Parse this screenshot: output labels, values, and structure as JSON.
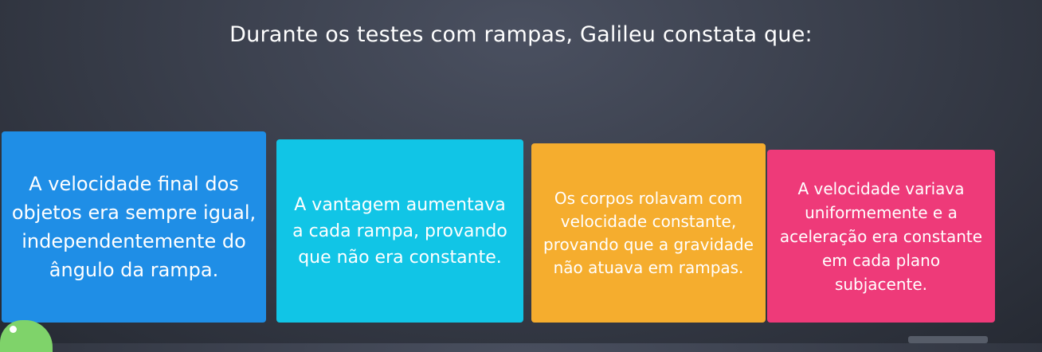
{
  "question": {
    "text": "Durante os testes com rampas, Galileu constata que:"
  },
  "answers": [
    {
      "text": "A velocidade final dos objetos era sempre igual, independentemente do ângulo da rampa.",
      "color": "#1f8ee6"
    },
    {
      "text": "A vantagem aumentava a cada rampa, provando que não era constante.",
      "color": "#11c5e6"
    },
    {
      "text": "Os corpos rolavam com velocidade constante, provando que a gravidade não atuava em rampas.",
      "color": "#f5ad2e"
    },
    {
      "text": "A velocidade variava uniformemente e a aceleração era constante em cada plano subjacente.",
      "color": "#ee3a79"
    }
  ],
  "mascot": {
    "icon": "frog-mascot-icon",
    "color": "#7fd36a"
  }
}
